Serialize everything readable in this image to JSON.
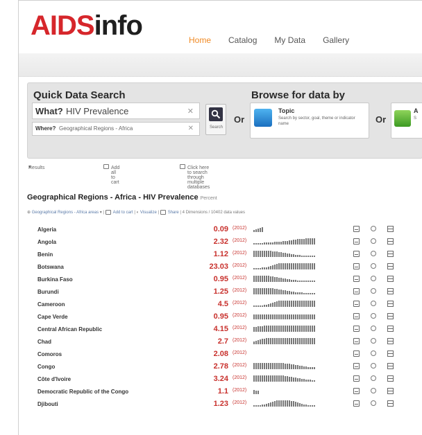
{
  "header": {
    "logo_red": "AIDS",
    "logo_dark": "info",
    "nav": [
      "Home",
      "Catalog",
      "My Data",
      "Gallery"
    ]
  },
  "search": {
    "title": "Quick Data Search",
    "what_label": "What?",
    "what_value": "HIV Prevalence",
    "where_label": "Where?",
    "where_value": "Geographical Regions - Africa",
    "search_label": "Search",
    "or_label": "Or"
  },
  "browse": {
    "title": "Browse for data by",
    "topic_title": "Topic",
    "topic_desc": "Search by sector, goal, theme or indicator name",
    "area_title": "A",
    "area_desc": "S"
  },
  "toolbar": {
    "results": "Results",
    "add_all": "Add all to cart",
    "click_here": "Click here to search through multiple databases"
  },
  "section": {
    "title": "Geographical Regions - Africa - HIV Prevalence",
    "unit": "Percent",
    "filter_regions": "Geographical Regions - Africa areas",
    "filter_add": "Add to cart",
    "filter_visualize": "Visualize",
    "filter_share": "Share",
    "filter_info": "4 Dimensions / 10402 data values"
  },
  "colors": {
    "accent_red": "#d6262b",
    "value_red": "#c8302c",
    "nav_active": "#f08a24"
  },
  "rows": [
    {
      "country": "Algeria",
      "value": "0.09",
      "year": "(2012)",
      "bars": [
        3,
        4,
        5,
        6,
        7
      ]
    },
    {
      "country": "Angola",
      "value": "2.32",
      "year": "(2012)",
      "bars": [
        2,
        2,
        2,
        2,
        2,
        3,
        3,
        3,
        3,
        3,
        4,
        4,
        4,
        4,
        5,
        5,
        5,
        6,
        6,
        7,
        7,
        8,
        8,
        8,
        8,
        9,
        9,
        9,
        9,
        9
      ]
    },
    {
      "country": "Benin",
      "value": "1.12",
      "year": "(2012)",
      "bars": [
        9,
        9,
        9,
        9,
        9,
        9,
        9,
        9,
        9,
        8,
        8,
        8,
        7,
        7,
        6,
        6,
        5,
        5,
        4,
        4,
        3,
        3,
        3,
        2,
        2,
        2,
        2,
        2,
        2,
        2
      ]
    },
    {
      "country": "Botswana",
      "value": "23.03",
      "year": "(2012)",
      "bars": [
        2,
        2,
        2,
        2,
        3,
        3,
        3,
        4,
        5,
        6,
        7,
        8,
        9,
        9,
        9,
        9,
        9,
        9,
        9,
        9,
        9,
        9,
        9,
        9,
        9,
        9,
        9,
        9,
        9,
        9
      ]
    },
    {
      "country": "Burkina Faso",
      "value": "0.95",
      "year": "(2012)",
      "bars": [
        9,
        9,
        9,
        9,
        9,
        9,
        9,
        9,
        8,
        8,
        7,
        7,
        6,
        6,
        5,
        5,
        4,
        4,
        3,
        3,
        3,
        2,
        2,
        2,
        2,
        2,
        2,
        2,
        2,
        2
      ]
    },
    {
      "country": "Burundi",
      "value": "1.25",
      "year": "(2012)",
      "bars": [
        9,
        9,
        9,
        9,
        9,
        9,
        9,
        9,
        9,
        9,
        8,
        8,
        7,
        7,
        6,
        6,
        5,
        5,
        4,
        4,
        3,
        3,
        3,
        3,
        2,
        2,
        2,
        2,
        2,
        2
      ]
    },
    {
      "country": "Cameroon",
      "value": "4.5",
      "year": "(2012)",
      "bars": [
        2,
        2,
        2,
        2,
        2,
        3,
        3,
        4,
        5,
        6,
        7,
        8,
        9,
        9,
        9,
        9,
        9,
        9,
        9,
        9,
        9,
        9,
        9,
        9,
        9,
        9,
        9,
        9,
        9,
        9
      ]
    },
    {
      "country": "Cape Verde",
      "value": "0.95",
      "year": "(2012)",
      "bars": [
        7,
        7,
        7,
        7,
        7,
        7,
        7,
        7,
        7,
        7,
        7,
        7,
        7,
        7,
        7,
        7,
        7,
        7,
        7,
        7,
        7,
        7,
        7,
        7,
        7,
        7,
        7,
        7,
        7,
        7
      ]
    },
    {
      "country": "Central African Republic",
      "value": "4.15",
      "year": "(2012)",
      "bars": [
        7,
        7,
        8,
        8,
        8,
        9,
        9,
        9,
        9,
        9,
        9,
        9,
        9,
        9,
        9,
        9,
        9,
        9,
        9,
        9,
        9,
        9,
        9,
        9,
        9,
        9,
        9,
        9,
        9,
        9
      ]
    },
    {
      "country": "Chad",
      "value": "2.7",
      "year": "(2012)",
      "bars": [
        4,
        5,
        6,
        7,
        8,
        8,
        9,
        9,
        9,
        9,
        9,
        9,
        9,
        9,
        9,
        9,
        9,
        9,
        9,
        9,
        9,
        9,
        9,
        9,
        9,
        9,
        9,
        9,
        9,
        9
      ]
    },
    {
      "country": "Comoros",
      "value": "2.08",
      "year": "(2012)",
      "bars": []
    },
    {
      "country": "Congo",
      "value": "2.78",
      "year": "(2012)",
      "bars": [
        9,
        9,
        9,
        9,
        9,
        9,
        9,
        9,
        9,
        9,
        9,
        9,
        9,
        9,
        9,
        8,
        8,
        8,
        7,
        7,
        6,
        6,
        5,
        5,
        4,
        4,
        3,
        3,
        3,
        3
      ]
    },
    {
      "country": "Côte d'Ivoire",
      "value": "3.24",
      "year": "(2012)",
      "bars": [
        9,
        9,
        9,
        9,
        9,
        9,
        9,
        9,
        9,
        9,
        9,
        9,
        9,
        9,
        9,
        8,
        8,
        7,
        7,
        6,
        6,
        5,
        5,
        4,
        4,
        3,
        3,
        3,
        2,
        2
      ]
    },
    {
      "country": "Democratic Republic of the Congo",
      "value": "1.1",
      "year": "(2012)",
      "bars": [
        6,
        5,
        5
      ]
    },
    {
      "country": "Djibouti",
      "value": "1.23",
      "year": "(2012)",
      "bars": [
        2,
        2,
        2,
        2,
        3,
        3,
        4,
        5,
        6,
        7,
        8,
        9,
        9,
        9,
        9,
        9,
        9,
        9,
        8,
        8,
        7,
        6,
        5,
        4,
        3,
        3,
        2,
        2,
        2,
        2
      ]
    }
  ]
}
